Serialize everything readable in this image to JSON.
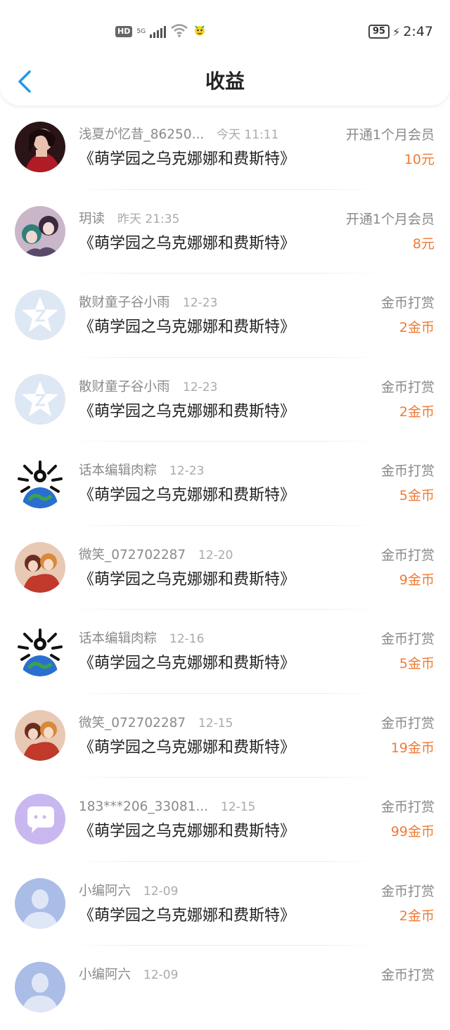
{
  "status_bar": {
    "hd_label": "HD",
    "network_label": "5G",
    "battery": "95",
    "time": "2:47"
  },
  "header": {
    "title": "收益",
    "back_icon": "chevron-left-icon",
    "accent_color": "#1e9be8"
  },
  "rows": [
    {
      "user": "浅夏が忆昔_86250...",
      "time": "今天 11:11",
      "book": "《萌学园之乌克娜娜和费斯特》",
      "type": "开通1个月会员",
      "amount": "10元",
      "avatar": "photo-woman-red-dress"
    },
    {
      "user": "玥读",
      "time": "昨天 21:35",
      "book": "《萌学园之乌克娜娜和费斯特》",
      "type": "开通1个月会员",
      "amount": "8元",
      "avatar": "anime-girls"
    },
    {
      "user": "散财童子谷小雨",
      "time": "12-23",
      "book": "《萌学园之乌克娜娜和费斯特》",
      "type": "金币打赏",
      "amount": "2金币",
      "avatar": "qq-star-default"
    },
    {
      "user": "散财童子谷小雨",
      "time": "12-23",
      "book": "《萌学园之乌克娜娜和费斯特》",
      "type": "金币打赏",
      "amount": "2金币",
      "avatar": "qq-star-default"
    },
    {
      "user": "话本编辑肉粽",
      "time": "12-23",
      "book": "《萌学园之乌克娜娜和费斯特》",
      "type": "金币打赏",
      "amount": "5金币",
      "avatar": "earth-bones"
    },
    {
      "user": "微笑_072702287",
      "time": "12-20",
      "book": "《萌学园之乌克娜娜和费斯特》",
      "type": "金币打赏",
      "amount": "9金币",
      "avatar": "doll-couple"
    },
    {
      "user": "话本编辑肉粽",
      "time": "12-16",
      "book": "《萌学园之乌克娜娜和费斯特》",
      "type": "金币打赏",
      "amount": "5金币",
      "avatar": "earth-bones"
    },
    {
      "user": "微笑_072702287",
      "time": "12-15",
      "book": "《萌学园之乌克娜娜和费斯特》",
      "type": "金币打赏",
      "amount": "19金币",
      "avatar": "doll-couple"
    },
    {
      "user": "183***206_33081...",
      "time": "12-15",
      "book": "《萌学园之乌克娜娜和费斯特》",
      "type": "金币打赏",
      "amount": "99金币",
      "avatar": "chat-bubble-default"
    },
    {
      "user": "小编阿六",
      "time": "12-09",
      "book": "《萌学园之乌克娜娜和费斯特》",
      "type": "金币打赏",
      "amount": "2金币",
      "avatar": "person-silhouette-default"
    },
    {
      "user": "小编阿六",
      "time": "12-09",
      "book": "",
      "type": "金币打赏",
      "amount": "",
      "avatar": "person-silhouette-default"
    }
  ]
}
